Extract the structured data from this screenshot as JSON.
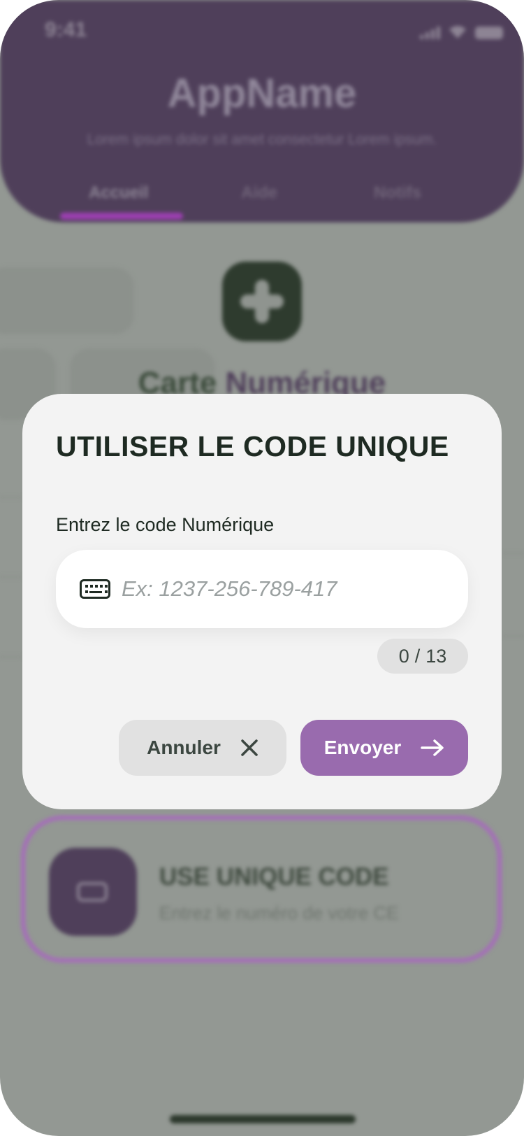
{
  "status_bar": {
    "time": "9:41"
  },
  "header": {
    "app_name": "AppName",
    "subtitle": "Lorem ipsum dolor sit amet consectetur Lorem ipsum.",
    "tabs": [
      {
        "label": "Accueil"
      },
      {
        "label": "Aide"
      },
      {
        "label": "Notifs"
      }
    ]
  },
  "background_card": {
    "title_part1": "Carte",
    "title_part2": "Numérique"
  },
  "code_card": {
    "title": "USE UNIQUE CODE",
    "subtitle": "Entrez le numéro de votre CE"
  },
  "modal": {
    "title": "UTILISER LE CODE UNIQUE",
    "field_label": "Entrez le code Numérique",
    "input_value": "",
    "input_placeholder": "Ex: 1237-256-789-417",
    "counter_current": "0",
    "counter_separator": "/",
    "counter_max": "13",
    "cancel_label": "Annuler",
    "send_label": "Envoyer"
  },
  "colors": {
    "header_bg": "#4f3f5a",
    "tab_indicator": "#9b3fb0",
    "send_button": "#996bae",
    "cancel_button": "#e1e1e1",
    "modal_bg": "#f3f3f3",
    "dark_text": "#1e2a22"
  },
  "icons": {
    "input_icon": "keyboard-icon",
    "cancel_icon": "close-icon",
    "send_icon": "arrow-right-icon",
    "tile_icon": "plus-icon",
    "code_card_icon": "card-icon"
  }
}
